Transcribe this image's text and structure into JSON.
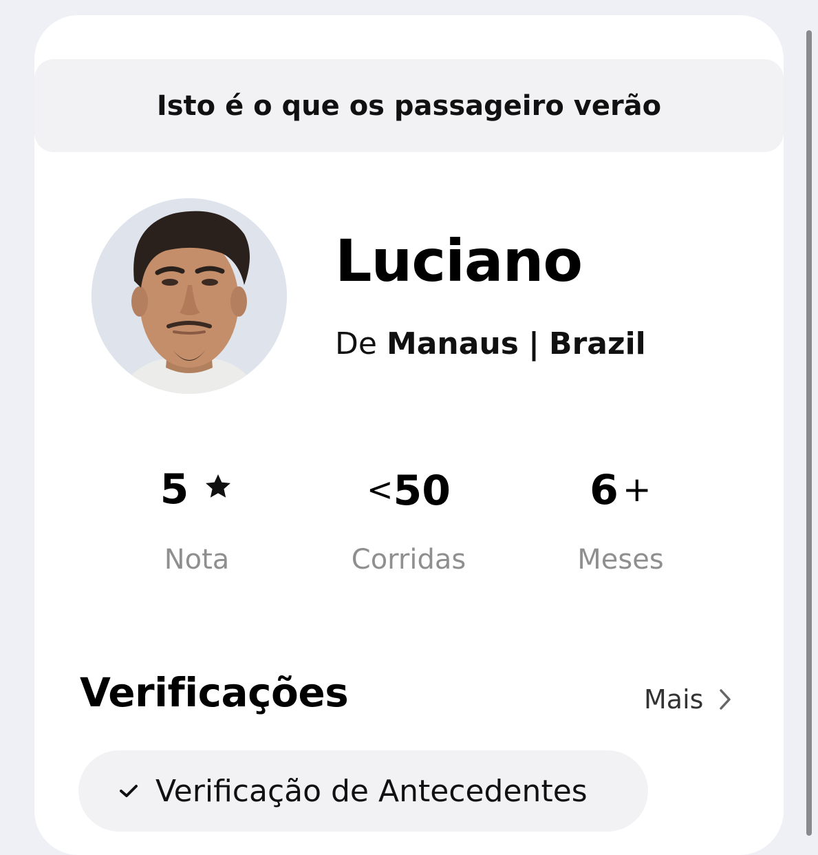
{
  "banner": {
    "text": "Isto é o que os passageiro verão"
  },
  "profile": {
    "name": "Luciano",
    "origin_prefix": "De",
    "city": "Manaus",
    "separator": "|",
    "country": "Brazil"
  },
  "stats": [
    {
      "value": "5",
      "suffix_icon": "star-icon",
      "label": "Nota"
    },
    {
      "prefix": "<",
      "value": "50",
      "label": "Corridas"
    },
    {
      "value": "6",
      "suffix": "+",
      "label": "Meses"
    }
  ],
  "verifications": {
    "title": "Verificações",
    "more_label": "Mais",
    "items": [
      {
        "label": "Verificação de Antecedentes",
        "icon": "check-icon"
      }
    ]
  },
  "colors": {
    "page_bg": "#eff0f5",
    "card_bg": "#ffffff",
    "muted_text": "#8f8f8f"
  }
}
